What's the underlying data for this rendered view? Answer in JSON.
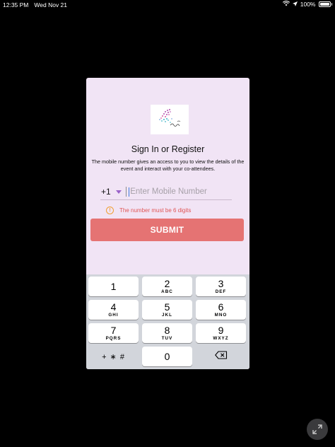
{
  "status_bar": {
    "time": "12:35 PM",
    "date": "Wed Nov 21",
    "battery_percent": "100%"
  },
  "modal": {
    "title": "Sign In or Register",
    "description": "The mobile number gives an access to you to view the details of the event and interact with your co-attendees.",
    "country_code": "+1",
    "phone_placeholder": "Enter Mobile Number",
    "phone_value": "",
    "error_message": "The number must be 6 digits",
    "submit_label": "SUBMIT"
  },
  "keyboard": {
    "keys": [
      {
        "num": "1",
        "letters": ""
      },
      {
        "num": "2",
        "letters": "ABC"
      },
      {
        "num": "3",
        "letters": "DEF"
      },
      {
        "num": "4",
        "letters": "GHI"
      },
      {
        "num": "5",
        "letters": "JKL"
      },
      {
        "num": "6",
        "letters": "MNO"
      },
      {
        "num": "7",
        "letters": "PQRS"
      },
      {
        "num": "8",
        "letters": "TUV"
      },
      {
        "num": "9",
        "letters": "WXYZ"
      }
    ],
    "symbols_label": "+ ∗ #",
    "zero": "0"
  },
  "colors": {
    "modal_bg": "#f1e4f5",
    "submit": "#e57373",
    "error": "#e05555",
    "warning": "#f0a033",
    "dropdown_caret": "#9a62c9"
  },
  "icons": [
    "wifi-icon",
    "location-arrow-icon",
    "battery-icon",
    "warning-icon",
    "dropdown-caret-icon",
    "backspace-icon",
    "expand-icon"
  ]
}
